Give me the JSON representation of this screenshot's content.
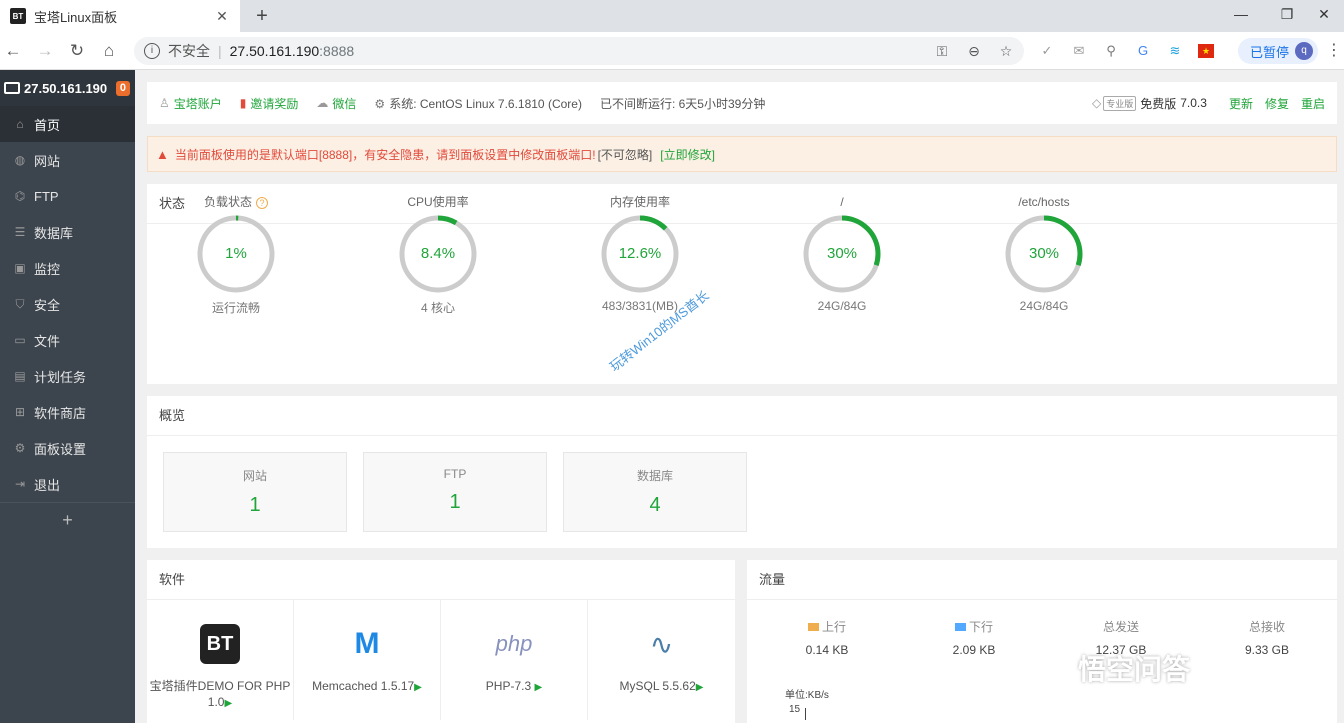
{
  "browser": {
    "tab_title": "宝塔Linux面板",
    "tab_icon_text": "BT",
    "address_insecure": "不安全",
    "address_host": "27.50.161.190",
    "address_port": ":8888",
    "profile_status": "已暂停",
    "profile_initial": "q"
  },
  "sidebar": {
    "server_ip": "27.50.161.190",
    "badge": "0",
    "items": [
      {
        "label": "首页",
        "icon": "home-icon"
      },
      {
        "label": "网站",
        "icon": "globe-icon"
      },
      {
        "label": "FTP",
        "icon": "ftp-icon"
      },
      {
        "label": "数据库",
        "icon": "database-icon"
      },
      {
        "label": "监控",
        "icon": "monitor-icon"
      },
      {
        "label": "安全",
        "icon": "shield-icon"
      },
      {
        "label": "文件",
        "icon": "folder-icon"
      },
      {
        "label": "计划任务",
        "icon": "calendar-icon"
      },
      {
        "label": "软件商店",
        "icon": "apps-icon"
      },
      {
        "label": "面板设置",
        "icon": "gear-icon"
      },
      {
        "label": "退出",
        "icon": "logout-icon"
      }
    ],
    "add_label": "+"
  },
  "topbar": {
    "account": "宝塔账户",
    "invite": "邀请奖励",
    "wechat": "微信",
    "system": "系统:  CentOS Linux 7.6.1810 (Core)",
    "uptime": "已不间断运行: 6天5小时39分钟",
    "pro_badge": "专业版",
    "edition": "免费版",
    "version": "7.0.3",
    "update": "更新",
    "repair": "修复",
    "restart": "重启"
  },
  "warning": {
    "text": "当前面板使用的是默认端口[8888]，有安全隐患，请到面板设置中修改面板端口!",
    "ignore": "[不可忽略]",
    "fix": "[立即修改]"
  },
  "status": {
    "title": "状态",
    "gauges": [
      {
        "label": "负载状态",
        "value": "1%",
        "percent": 1,
        "sub": "运行流畅"
      },
      {
        "label": "CPU使用率",
        "value": "8.4%",
        "percent": 8.4,
        "sub": "4 核心"
      },
      {
        "label": "内存使用率",
        "value": "12.6%",
        "percent": 12.6,
        "sub": "483/3831(MB)"
      },
      {
        "label": "/",
        "value": "30%",
        "percent": 30,
        "sub": "24G/84G"
      },
      {
        "label": "/etc/hosts",
        "value": "30%",
        "percent": 30,
        "sub": "24G/84G"
      }
    ],
    "watermark": "玩转Win10的MS酋长"
  },
  "overview": {
    "title": "概览",
    "boxes": [
      {
        "label": "网站",
        "value": "1"
      },
      {
        "label": "FTP",
        "value": "1"
      },
      {
        "label": "数据库",
        "value": "4"
      }
    ]
  },
  "software": {
    "title": "软件",
    "items": [
      {
        "name": "宝塔插件DEMO FOR PHP 1.0"
      },
      {
        "name": "Memcached 1.5.17"
      },
      {
        "name": "PHP-7.3"
      },
      {
        "name": "MySQL 5.5.62"
      }
    ]
  },
  "traffic": {
    "title": "流量",
    "up_label": "上行",
    "up_value": "0.14 KB",
    "down_label": "下行",
    "down_value": "2.09 KB",
    "sent_label": "总发送",
    "sent_value": "12.37 GB",
    "recv_label": "总接收",
    "recv_value": "9.33 GB",
    "unit": "单位:KB/s",
    "axis_top": "15",
    "up_color": "#f0ad4e",
    "down_color": "#52a9ff"
  },
  "watermark2": "悟空问答"
}
